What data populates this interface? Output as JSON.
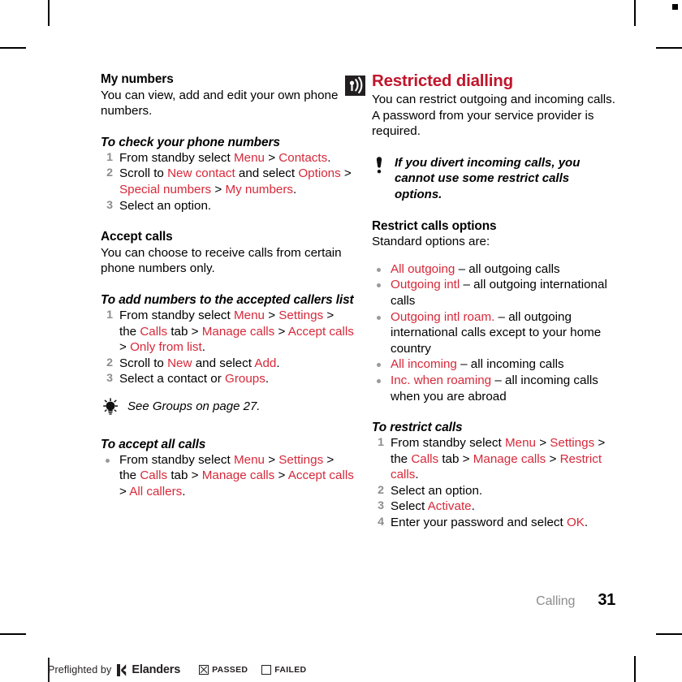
{
  "document": {
    "footer": {
      "chapter": "Calling",
      "page_number": "31"
    }
  },
  "left_column": {
    "my_numbers": {
      "heading": "My numbers",
      "body": "You can view, add and edit your own phone numbers.",
      "procedure_title": "To check your phone numbers",
      "steps": [
        {
          "parts": [
            {
              "t": "From standby select ",
              "c": "black"
            },
            {
              "t": "Menu",
              "c": "red"
            },
            {
              "t": " > ",
              "c": "black"
            },
            {
              "t": "Contacts",
              "c": "red"
            },
            {
              "t": ".",
              "c": "black"
            }
          ]
        },
        {
          "parts": [
            {
              "t": "Scroll to ",
              "c": "black"
            },
            {
              "t": "New contact",
              "c": "red"
            },
            {
              "t": " and select ",
              "c": "black"
            },
            {
              "t": "Options",
              "c": "red"
            },
            {
              "t": " > ",
              "c": "black"
            },
            {
              "t": "Special numbers",
              "c": "red"
            },
            {
              "t": " > ",
              "c": "black"
            },
            {
              "t": "My numbers",
              "c": "red"
            },
            {
              "t": ".",
              "c": "black"
            }
          ]
        },
        {
          "parts": [
            {
              "t": "Select an option.",
              "c": "black"
            }
          ]
        }
      ]
    },
    "accept_calls": {
      "heading": "Accept calls",
      "body": "You can choose to receive calls from certain phone numbers only.",
      "procedure_title": "To add numbers to the accepted callers list",
      "steps": [
        {
          "parts": [
            {
              "t": "From standby select ",
              "c": "black"
            },
            {
              "t": "Menu",
              "c": "red"
            },
            {
              "t": " > ",
              "c": "black"
            },
            {
              "t": "Settings",
              "c": "red"
            },
            {
              "t": " > the ",
              "c": "black"
            },
            {
              "t": "Calls",
              "c": "red"
            },
            {
              "t": " tab > ",
              "c": "black"
            },
            {
              "t": "Manage calls",
              "c": "red"
            },
            {
              "t": " > ",
              "c": "black"
            },
            {
              "t": "Accept calls",
              "c": "red"
            },
            {
              "t": " > ",
              "c": "black"
            },
            {
              "t": "Only from list",
              "c": "red"
            },
            {
              "t": ".",
              "c": "black"
            }
          ]
        },
        {
          "parts": [
            {
              "t": "Scroll to ",
              "c": "black"
            },
            {
              "t": "New",
              "c": "red"
            },
            {
              "t": " and select ",
              "c": "black"
            },
            {
              "t": "Add",
              "c": "red"
            },
            {
              "t": ".",
              "c": "black"
            }
          ]
        },
        {
          "parts": [
            {
              "t": "Select a contact or ",
              "c": "black"
            },
            {
              "t": "Groups",
              "c": "red"
            },
            {
              "t": ".",
              "c": "black"
            }
          ]
        }
      ],
      "tip": {
        "icon": "lightbulb-icon",
        "text": "See Groups on page 27."
      }
    },
    "accept_all_calls": {
      "procedure_title": "To accept all calls",
      "bullets": [
        {
          "parts": [
            {
              "t": "From standby select ",
              "c": "black"
            },
            {
              "t": "Menu",
              "c": "red"
            },
            {
              "t": " > ",
              "c": "black"
            },
            {
              "t": "Settings",
              "c": "red"
            },
            {
              "t": " > the ",
              "c": "black"
            },
            {
              "t": "Calls",
              "c": "red"
            },
            {
              "t": " tab > ",
              "c": "black"
            },
            {
              "t": "Manage calls",
              "c": "red"
            },
            {
              "t": " > ",
              "c": "black"
            },
            {
              "t": "Accept calls",
              "c": "red"
            },
            {
              "t": " > ",
              "c": "black"
            },
            {
              "t": "All callers",
              "c": "red"
            },
            {
              "t": ".",
              "c": "black"
            }
          ]
        }
      ]
    }
  },
  "right_column": {
    "section": {
      "icon": "signal-antenna-icon",
      "heading": "Restricted dialling",
      "body": "You can restrict outgoing and incoming calls. A password from your service provider is required."
    },
    "note": {
      "icon": "exclamation-icon",
      "text": "If you divert incoming calls, you cannot use some restrict calls options."
    },
    "restrict_options": {
      "heading": "Restrict calls options",
      "intro": "Standard options are:",
      "bullets": [
        {
          "parts": [
            {
              "t": "All outgoing",
              "c": "red"
            },
            {
              "t": " – all outgoing calls",
              "c": "black"
            }
          ]
        },
        {
          "parts": [
            {
              "t": "Outgoing intl",
              "c": "red"
            },
            {
              "t": " – all outgoing international calls",
              "c": "black"
            }
          ]
        },
        {
          "parts": [
            {
              "t": "Outgoing intl roam.",
              "c": "red"
            },
            {
              "t": " – all outgoing international calls except to your home country",
              "c": "black"
            }
          ]
        },
        {
          "parts": [
            {
              "t": "All incoming",
              "c": "red"
            },
            {
              "t": " – all incoming calls",
              "c": "black"
            }
          ]
        },
        {
          "parts": [
            {
              "t": "Inc. when roaming",
              "c": "red"
            },
            {
              "t": " – all incoming calls when you are abroad",
              "c": "black"
            }
          ]
        }
      ]
    },
    "restrict_procedure": {
      "procedure_title": "To restrict calls",
      "steps": [
        {
          "parts": [
            {
              "t": "From standby select ",
              "c": "black"
            },
            {
              "t": "Menu",
              "c": "red"
            },
            {
              "t": " > ",
              "c": "black"
            },
            {
              "t": "Settings",
              "c": "red"
            },
            {
              "t": " > the ",
              "c": "black"
            },
            {
              "t": "Calls",
              "c": "red"
            },
            {
              "t": " tab > ",
              "c": "black"
            },
            {
              "t": "Manage calls",
              "c": "red"
            },
            {
              "t": " > ",
              "c": "black"
            },
            {
              "t": "Restrict calls",
              "c": "red"
            },
            {
              "t": ".",
              "c": "black"
            }
          ]
        },
        {
          "parts": [
            {
              "t": "Select an option.",
              "c": "black"
            }
          ]
        },
        {
          "parts": [
            {
              "t": "Select ",
              "c": "black"
            },
            {
              "t": "Activate",
              "c": "red"
            },
            {
              "t": ".",
              "c": "black"
            }
          ]
        },
        {
          "parts": [
            {
              "t": "Enter your password and select ",
              "c": "black"
            },
            {
              "t": "OK",
              "c": "red"
            },
            {
              "t": ".",
              "c": "black"
            }
          ]
        }
      ]
    }
  },
  "preflight_bar": {
    "prefix": "Preflighted by",
    "brand": "Elanders",
    "passed_label": "PASSED",
    "failed_label": "FAILED",
    "passed_checked": true,
    "failed_checked": false
  },
  "colors": {
    "heading_red": "#c0152b",
    "link_red": "#d6293a",
    "step_number_gray": "#8d8d8d",
    "bullet_gray": "#9a9a9a",
    "chapter_gray": "#8d8d8d",
    "icon_dark": "#231f20"
  }
}
